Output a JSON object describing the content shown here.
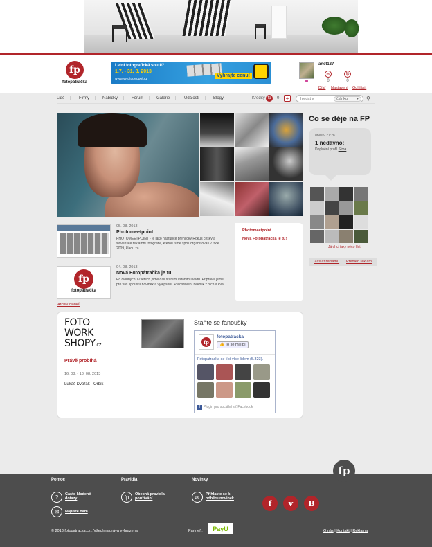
{
  "header": {
    "logo_text": "fotopátračka",
    "promo": {
      "line1": "Letní fotografická soutěž",
      "line2": "1.7. - 31. 8. 2013",
      "line3": "www.vytotopeopot.cz",
      "cta": "Vyhrajte cenu!"
    },
    "user": {
      "username": "anet137",
      "counts": [
        "0",
        "0"
      ],
      "links": [
        "Díař",
        "Nastavení",
        "Odhlásit"
      ]
    }
  },
  "nav": {
    "items": [
      "Lidé",
      "Firmy",
      "Nabídky",
      "Fórum",
      "Galerie",
      "Události",
      "Blogy"
    ],
    "kredity_label": "Kredity",
    "kredity_count": "0",
    "search_placeholder": "hledat v",
    "search_scope": "článku"
  },
  "sidebar": {
    "title": "Co se děje na FP",
    "activity": {
      "time": "dnes v 21:28",
      "heading": "1 nedávno:",
      "text_prefix": "Doplnění profil",
      "text_link": "Šíma"
    },
    "mosaic_link": "Já chci taky něco říct",
    "tabs": [
      "Zaslat reklamu",
      "Přehled reklam"
    ]
  },
  "articles": [
    {
      "date": "05. 08. 2013",
      "title": "Photomeetpoint",
      "text": "PHOTOMEETPOINT - je jako nástupce přehlídky Rokus český a slovenské reklamní fotografie, kterou jsme spoluorganizovali v roce 2009, kladu za..."
    },
    {
      "date": "04. 08. 2013",
      "title": "Nová Fotopátračka je tu!",
      "text": "Po dlouhých 12 letech jsme dali starému stanimu vedu. Připravili jsme pro vás spoustu novinek a vylepšení. Představení několik z nich a kvá..."
    }
  ],
  "article_panel": {
    "links": [
      "Photomeetpoint",
      "Nová Fotopátračka je tu!"
    ]
  },
  "archive_link": "Archiv článků",
  "workshop": {
    "logo_lines": [
      "FOTO",
      "WORK",
      "SHOPY",
      ".cz"
    ],
    "heading": "Právě probíhá",
    "dates": "16. 08. - 18. 08. 2013",
    "name": "Lukáš Dvořák - Orbik"
  },
  "facebook": {
    "title": "Staňte se fanoušky",
    "page_name": "fotopatracka",
    "like_label": "To se mi líbí",
    "count_text": "Fotopatracka se líbí více lidem (5.323).",
    "plugin_text": "Plugin pro sociální síť Facebook"
  },
  "footer": {
    "columns": [
      {
        "heading": "Pomoc",
        "links": [
          "Často kladené dotazy",
          "Napište nám"
        ]
      },
      {
        "heading": "Pravidla",
        "links": [
          "Obecná pravidla používání"
        ]
      },
      {
        "heading": "Novinky",
        "links": [
          "Přihlaste se k odběru novinek"
        ]
      }
    ],
    "social": [
      "f",
      "v",
      "B"
    ],
    "copyright": "© 2013 fotopatracka.cz . Všechna práva vyhrazena",
    "partner_label": "Partneři:",
    "partner_name": "PayU",
    "bottom_links": [
      "O nás",
      "Kontakt",
      "Reklama"
    ]
  },
  "colors": {
    "brand_red": "#b1252a",
    "footer_bg": "#4d4d4d",
    "page_bg": "#ebebeb"
  }
}
